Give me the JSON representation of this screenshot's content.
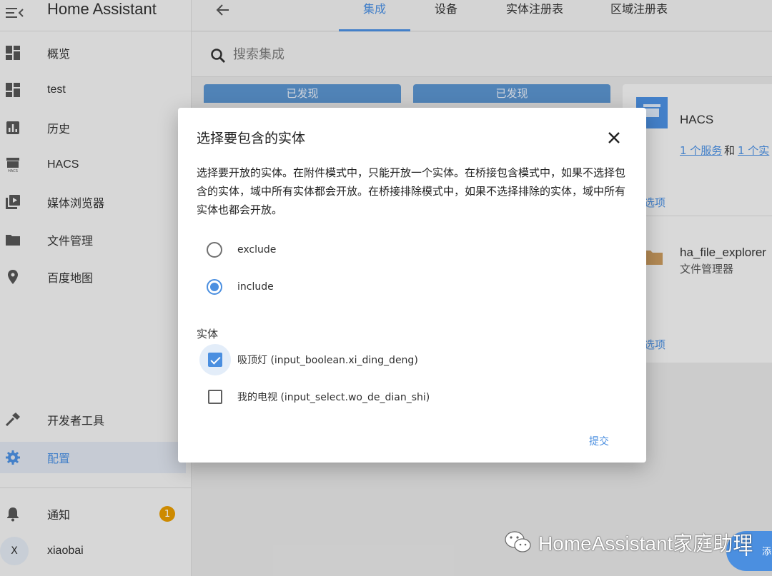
{
  "app": {
    "title": "Home Assistant"
  },
  "sidebar": {
    "items": [
      {
        "label": "概览",
        "icon": "dashboard-icon"
      },
      {
        "label": "test",
        "icon": "dashboard-icon"
      },
      {
        "label": "历史",
        "icon": "chart-icon"
      },
      {
        "label": "HACS",
        "icon": "hacs-icon"
      },
      {
        "label": "媒体浏览器",
        "icon": "media-icon"
      },
      {
        "label": "文件管理",
        "icon": "folder-icon"
      },
      {
        "label": "百度地图",
        "icon": "map-pin-icon"
      }
    ],
    "bottom_items": [
      {
        "label": "开发者工具",
        "icon": "hammer-icon"
      },
      {
        "label": "配置",
        "icon": "gear-icon",
        "active": true
      }
    ],
    "notifications": {
      "label": "通知",
      "count": "1"
    },
    "user": {
      "initial": "X",
      "name": "xiaobai"
    }
  },
  "tabs": [
    {
      "label": "集成",
      "active": true
    },
    {
      "label": "设备"
    },
    {
      "label": "实体注册表"
    },
    {
      "label": "区域注册表"
    }
  ],
  "search": {
    "placeholder": "搜索集成"
  },
  "discovered": [
    {
      "label": "已发现"
    },
    {
      "label": "已发现"
    }
  ],
  "integrations": [
    {
      "title": "HACS",
      "links": [
        "1 个服务",
        "和",
        "1 个实"
      ],
      "options": "选项"
    },
    {
      "title": "ha_file_explorer",
      "subtitle": "文件管理器",
      "options": "选项"
    }
  ],
  "dialog": {
    "title": "选择要包含的实体",
    "description": "选择要开放的实体。在附件模式中，只能开放一个实体。在桥接包含模式中，如果不选择包含的实体，域中所有实体都会开放。在桥接排除模式中，如果不选择排除的实体，域中所有实体也都会开放。",
    "modes": [
      {
        "label": "exclude",
        "checked": false
      },
      {
        "label": "include",
        "checked": true
      }
    ],
    "entities_label": "实体",
    "entities": [
      {
        "label": "吸顶灯 (input_boolean.xi_ding_deng)",
        "checked": true
      },
      {
        "label": "我的电视 (input_select.wo_de_dian_shi)",
        "checked": false
      }
    ],
    "submit": "提交"
  },
  "fab": {
    "label": "添"
  },
  "watermark": "HomeAssistant家庭助理",
  "colors": {
    "accent": "#4b8fe0",
    "badge": "#e59a00",
    "discovered": "#5a92cc"
  }
}
